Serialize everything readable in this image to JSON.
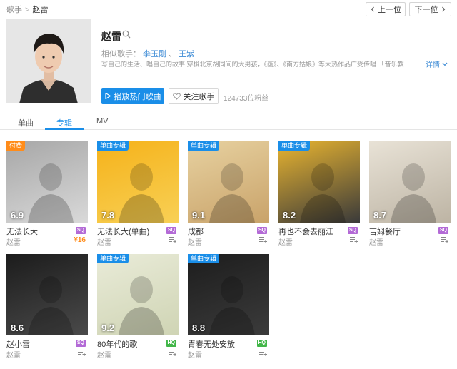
{
  "breadcrumb": {
    "root": "歌手",
    "separator": ">",
    "current": "赵雷"
  },
  "nav": {
    "prev": "上一位",
    "next": "下一位"
  },
  "artist": {
    "name": "赵雷",
    "similar_label": "相似歌手：",
    "similar": [
      "李玉刚",
      "王紫"
    ],
    "similar_sep": "、",
    "description": "写自己的生活、唱自己的故事 穿梭北京胡同间的大男孩，《画》、《南方姑娘》等大热作品广受传唱 「音乐教...",
    "more": "详情",
    "play_button": "播放热门歌曲",
    "follow_button": "关注歌手",
    "fans": "124733位粉丝"
  },
  "tabs": [
    "单曲",
    "专辑",
    "MV"
  ],
  "active_tab": 1,
  "albums": [
    {
      "title": "无法长大",
      "artist": "赵雷",
      "score": "6.9",
      "badge": "付费",
      "badge_type": "pay",
      "quality": "SQ",
      "price": "¥16",
      "colors": [
        "#a7a7a7",
        "#d9d9d9"
      ]
    },
    {
      "title": "无法长大(单曲)",
      "artist": "赵雷",
      "score": "7.8",
      "badge": "单曲专辑",
      "badge_type": "single",
      "quality": "SQ",
      "price": "",
      "colors": [
        "#f5b21a",
        "#f8d055"
      ]
    },
    {
      "title": "成都",
      "artist": "赵雷",
      "score": "9.1",
      "badge": "单曲专辑",
      "badge_type": "single",
      "quality": "SQ",
      "price": "",
      "colors": [
        "#e7d1a0",
        "#c9a36a"
      ]
    },
    {
      "title": "再也不会去丽江",
      "artist": "赵雷",
      "score": "8.2",
      "badge": "单曲专辑",
      "badge_type": "single",
      "quality": "SQ",
      "price": "",
      "colors": [
        "#e8b430",
        "#3a3a3a"
      ]
    },
    {
      "title": "吉姆餐厅",
      "artist": "赵雷",
      "score": "8.7",
      "badge": "",
      "badge_type": "",
      "quality": "SQ",
      "price": "",
      "colors": [
        "#e8e2d6",
        "#bdb4a4"
      ]
    },
    {
      "title": "赵小雷",
      "artist": "赵雷",
      "score": "8.6",
      "badge": "",
      "badge_type": "",
      "quality": "SQ",
      "price": "",
      "colors": [
        "#1c1c1c",
        "#4a4a4a"
      ]
    },
    {
      "title": "80年代的歌",
      "artist": "赵雷",
      "score": "9.2",
      "badge": "单曲专辑",
      "badge_type": "single",
      "quality": "HQ",
      "price": "",
      "colors": [
        "#e9ebd8",
        "#cfd4b4"
      ]
    },
    {
      "title": "青春无处安放",
      "artist": "赵雷",
      "score": "8.8",
      "badge": "单曲专辑",
      "badge_type": "single",
      "quality": "HQ",
      "price": "",
      "colors": [
        "#1d1d1d",
        "#3b3b3b"
      ]
    }
  ]
}
